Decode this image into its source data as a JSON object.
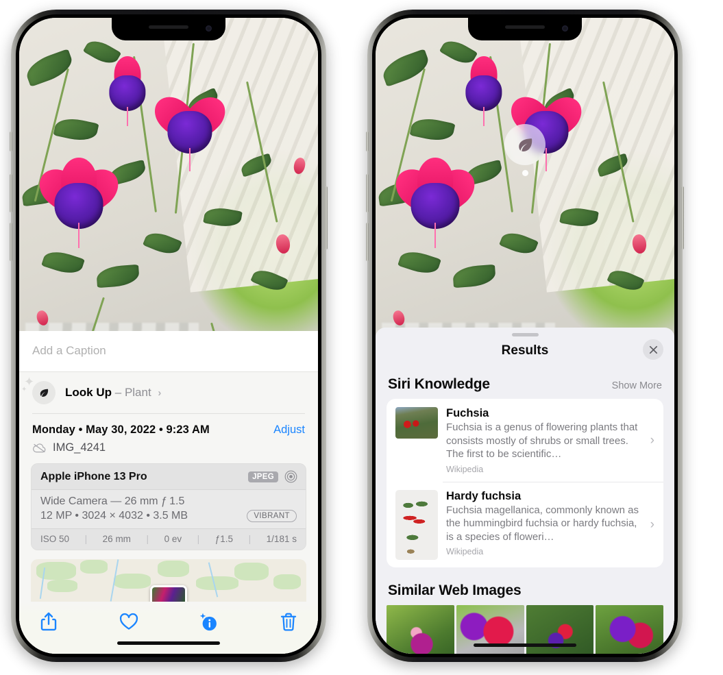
{
  "left_phone": {
    "caption": {
      "placeholder": "Add a Caption",
      "value": ""
    },
    "lookup": {
      "label": "Look Up",
      "dash": "–",
      "subject": "Plant",
      "chevron": "›",
      "icon": "leaf-icon"
    },
    "meta": {
      "date": "Monday • May 30, 2022 • 9:23 AM",
      "adjust_label": "Adjust",
      "filename": "IMG_4241",
      "cloud_icon": "cloud-slash-icon"
    },
    "camera_card": {
      "device": "Apple iPhone 13 Pro",
      "format_badge": "JPEG",
      "raw_icon": "target-icon",
      "lens": "Wide Camera — 26 mm ƒ 1.5",
      "specs": "12 MP • 3024 × 4032 • 3.5 MB",
      "style_badge": "VIBRANT",
      "exif": [
        "ISO 50",
        "26 mm",
        "0 ev",
        "ƒ1.5",
        "1/181 s"
      ]
    },
    "toolbar": {
      "share_label": "share-icon",
      "favorite_label": "heart-icon",
      "info_label": "info-sparkle-icon",
      "delete_label": "trash-icon"
    }
  },
  "right_phone": {
    "marker": {
      "icon": "leaf-icon"
    },
    "sheet": {
      "title": "Results",
      "close_label": "✕"
    },
    "siri_knowledge": {
      "heading": "Siri Knowledge",
      "show_more": "Show More",
      "items": [
        {
          "title": "Fuchsia",
          "description": "Fuchsia is a genus of flowering plants that consists mostly of shrubs or small trees. The first to be scientific…",
          "source": "Wikipedia",
          "chevron": "›"
        },
        {
          "title": "Hardy fuchsia",
          "description": "Fuchsia magellanica, commonly known as the hummingbird fuchsia or hardy fuchsia, is a species of floweri…",
          "source": "Wikipedia",
          "chevron": "›"
        }
      ]
    },
    "similar_web_images": {
      "heading": "Similar Web Images",
      "count": 4
    }
  },
  "colors": {
    "accent_blue": "#1a85ff",
    "sheet_bg": "#f0f0f4",
    "card_bg": "#ffffff",
    "secondary_text": "#8e8e93"
  }
}
